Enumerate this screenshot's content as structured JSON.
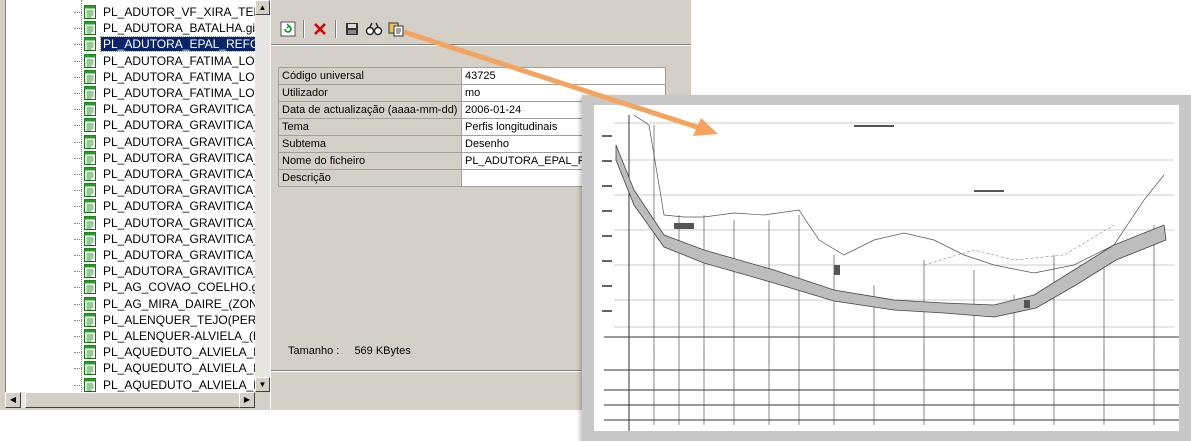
{
  "tree": {
    "items": [
      {
        "label": "PL_ADUTOR_VF_XIRA_TEL",
        "selected": false
      },
      {
        "label": "PL_ADUTORA_BATALHA.gi",
        "selected": false
      },
      {
        "label": "PL_ADUTORA_EPAL_REFC",
        "selected": true
      },
      {
        "label": "PL_ADUTORA_FATIMA_LOU",
        "selected": false
      },
      {
        "label": "PL_ADUTORA_FATIMA_LOU",
        "selected": false
      },
      {
        "label": "PL_ADUTORA_FATIMA_LOU",
        "selected": false
      },
      {
        "label": "PL_ADUTORA_GRAVITICA_",
        "selected": false
      },
      {
        "label": "PL_ADUTORA_GRAVITICA_",
        "selected": false
      },
      {
        "label": "PL_ADUTORA_GRAVITICA_",
        "selected": false
      },
      {
        "label": "PL_ADUTORA_GRAVITICA_",
        "selected": false
      },
      {
        "label": "PL_ADUTORA_GRAVITICA_",
        "selected": false
      },
      {
        "label": "PL_ADUTORA_GRAVITICA_",
        "selected": false
      },
      {
        "label": "PL_ADUTORA_GRAVITICA_",
        "selected": false
      },
      {
        "label": "PL_ADUTORA_GRAVITICA_",
        "selected": false
      },
      {
        "label": "PL_ADUTORA_GRAVITICA_",
        "selected": false
      },
      {
        "label": "PL_ADUTORA_GRAVITICA_",
        "selected": false
      },
      {
        "label": "PL_ADUTORA_GRAVITICA_",
        "selected": false
      },
      {
        "label": "PL_AG_COVAO_COELHO.g",
        "selected": false
      },
      {
        "label": "PL_AG_MIRA_DAIRE_(ZONA",
        "selected": false
      },
      {
        "label": "PL_ALENQUER_TEJO(PERI",
        "selected": false
      },
      {
        "label": "PL_ALENQUER-ALVIELA_(F",
        "selected": false
      },
      {
        "label": "PL_AQUEDUTO_ALVIELA_F",
        "selected": false
      },
      {
        "label": "PL_AQUEDUTO_ALVIELA_F",
        "selected": false
      },
      {
        "label": "PL_AQUEDUTO_ALVIELA_F",
        "selected": false
      }
    ]
  },
  "toolbar": {
    "icons": [
      "refresh-icon",
      "delete-icon",
      "save-icon",
      "search-icon",
      "copy-icon"
    ]
  },
  "properties": [
    {
      "key": "Código universal",
      "value": "43725"
    },
    {
      "key": "Utilizador",
      "value": "mo"
    },
    {
      "key": "Data de actualização (aaaa-mm-dd)",
      "value": "2006-01-24"
    },
    {
      "key": "Tema",
      "value": "Perfis longitudinais"
    },
    {
      "key": "Subtema",
      "value": "Desenho"
    },
    {
      "key": "Nome do ficheiro",
      "value": "PL_ADUTORA_EPAL_REFC"
    },
    {
      "key": "Descrição",
      "value": ""
    }
  ],
  "size": {
    "label": "Tamanho :",
    "value": "569 KBytes"
  },
  "colors": {
    "selection": "#0a246a",
    "arrow": "#f4a460",
    "chrome": "#d4d0c8"
  }
}
